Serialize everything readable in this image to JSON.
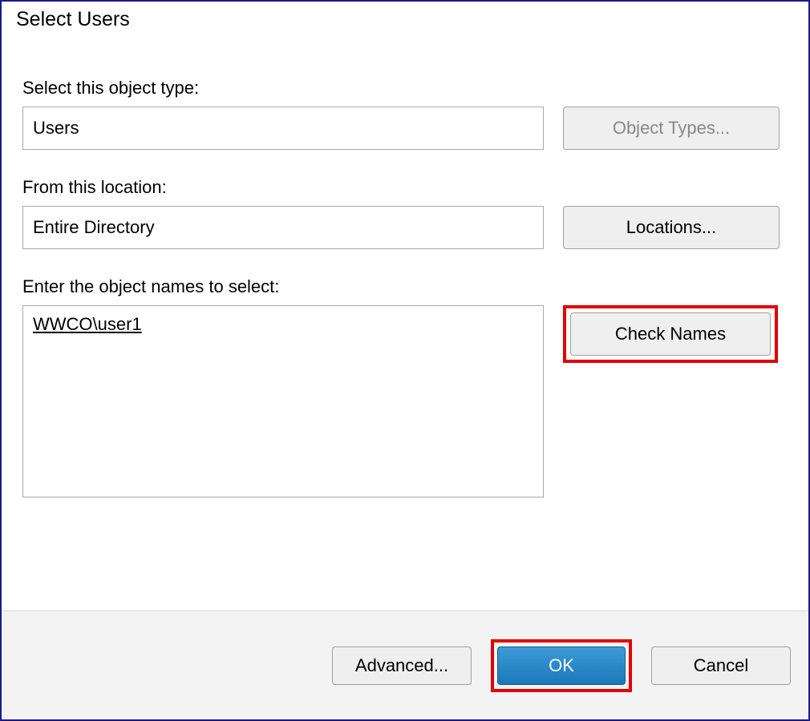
{
  "title": "Select Users",
  "object_type": {
    "label": "Select this object type:",
    "value": "Users",
    "button": "Object Types..."
  },
  "location": {
    "label": "From this location:",
    "value": "Entire Directory",
    "button": "Locations..."
  },
  "names": {
    "label": "Enter the object names to select:",
    "value": "WWCO\\user1",
    "button": "Check Names"
  },
  "footer": {
    "advanced": "Advanced...",
    "ok": "OK",
    "cancel": "Cancel"
  }
}
